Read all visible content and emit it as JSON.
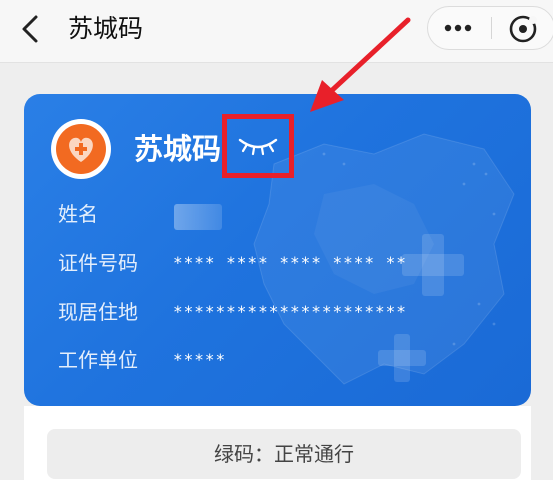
{
  "header": {
    "title": "苏城码"
  },
  "card": {
    "title": "苏城码",
    "fields": [
      {
        "label": "姓名",
        "value": ""
      },
      {
        "label": "证件号码",
        "value": "**** **** **** **** **"
      },
      {
        "label": "现居住地",
        "value": "**********************"
      },
      {
        "label": "工作单位",
        "value": "*****"
      }
    ]
  },
  "status": {
    "text": "绿码：正常通行"
  },
  "colors": {
    "card_blue": "#2a7fe6",
    "logo_orange": "#f26a21",
    "annotation_red": "#e8202a"
  },
  "icons": [
    "back-icon",
    "more-icon",
    "close-mini-icon",
    "logo-icon",
    "eye-closed-icon"
  ]
}
